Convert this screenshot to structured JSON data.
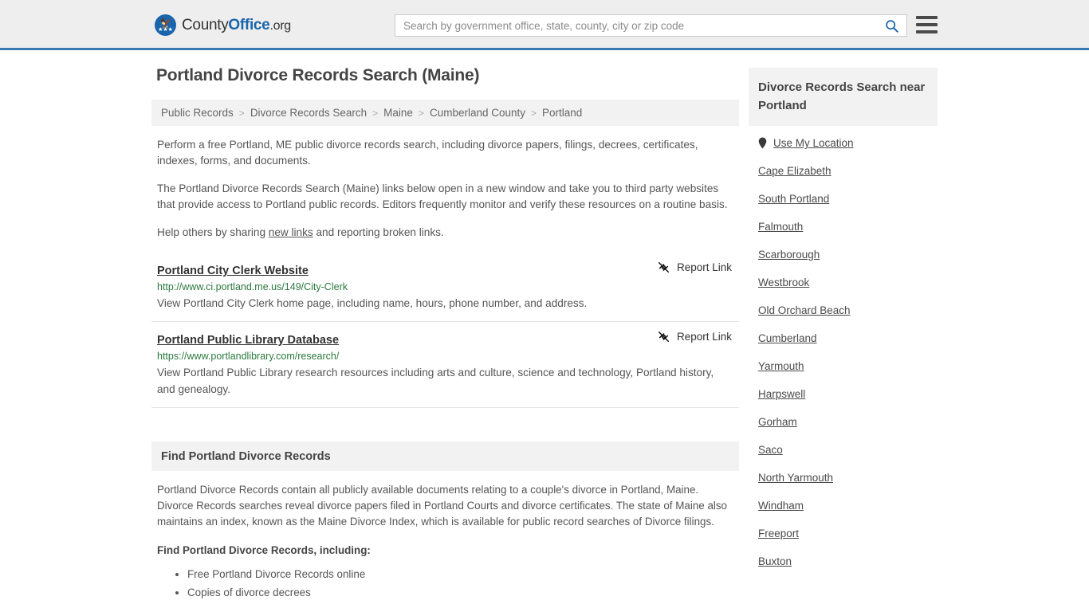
{
  "header": {
    "logo": {
      "part1": "County",
      "part2": "Office",
      "part3": ".org",
      "icon": "eagle-seal-icon"
    },
    "search": {
      "placeholder": "Search by government office, state, county, city or zip code",
      "value": "",
      "icon": "search-icon"
    },
    "menu_icon": "hamburger-menu-icon",
    "accent_color": "#3b7ab0"
  },
  "page": {
    "title": "Portland Divorce Records Search (Maine)"
  },
  "breadcrumb": {
    "items": [
      {
        "label": "Public Records"
      },
      {
        "label": "Divorce Records Search"
      },
      {
        "label": "Maine"
      },
      {
        "label": "Cumberland County"
      },
      {
        "label": "Portland"
      }
    ],
    "separator": ">"
  },
  "intro": {
    "p1": "Perform a free Portland, ME public divorce records search, including divorce papers, filings, decrees, certificates, indexes, forms, and documents.",
    "p2": "The Portland Divorce Records Search (Maine) links below open in a new window and take you to third party websites that provide access to Portland public records. Editors frequently monitor and verify these resources on a routine basis.",
    "p3_before": "Help others by sharing ",
    "p3_link": "new links",
    "p3_after": " and reporting broken links."
  },
  "results": [
    {
      "title": "Portland City Clerk Website",
      "report_label": "Report Link",
      "report_icon": "broken-link-icon",
      "url": "http://www.ci.portland.me.us/149/City-Clerk",
      "description": "View Portland City Clerk home page, including name, hours, phone number, and address."
    },
    {
      "title": "Portland Public Library Database",
      "report_label": "Report Link",
      "report_icon": "broken-link-icon",
      "url": "https://www.portlandlibrary.com/research/",
      "description": "View Portland Public Library research resources including arts and culture, science and technology, Portland history, and genealogy."
    }
  ],
  "section": {
    "heading": "Find Portland Divorce Records",
    "paragraph": "Portland Divorce Records contain all publicly available documents relating to a couple's divorce in Portland, Maine. Divorce Records searches reveal divorce papers filed in Portland Courts and divorce certificates. The state of Maine also maintains an index, known as the Maine Divorce Index, which is available for public record searches of Divorce filings.",
    "list_lead": "Find Portland Divorce Records, including:",
    "list_items": [
      "Free Portland Divorce Records online",
      "Copies of divorce decrees"
    ]
  },
  "sidebar": {
    "heading": "Divorce Records Search near Portland",
    "use_my_location": {
      "label": "Use My Location",
      "icon": "map-pin-icon"
    },
    "items": [
      {
        "label": "Cape Elizabeth"
      },
      {
        "label": "South Portland"
      },
      {
        "label": "Falmouth"
      },
      {
        "label": "Scarborough"
      },
      {
        "label": "Westbrook"
      },
      {
        "label": "Old Orchard Beach"
      },
      {
        "label": "Cumberland"
      },
      {
        "label": "Yarmouth"
      },
      {
        "label": "Harpswell"
      },
      {
        "label": "Gorham"
      },
      {
        "label": "Saco"
      },
      {
        "label": "North Yarmouth"
      },
      {
        "label": "Windham"
      },
      {
        "label": "Freeport"
      },
      {
        "label": "Buxton"
      }
    ]
  }
}
